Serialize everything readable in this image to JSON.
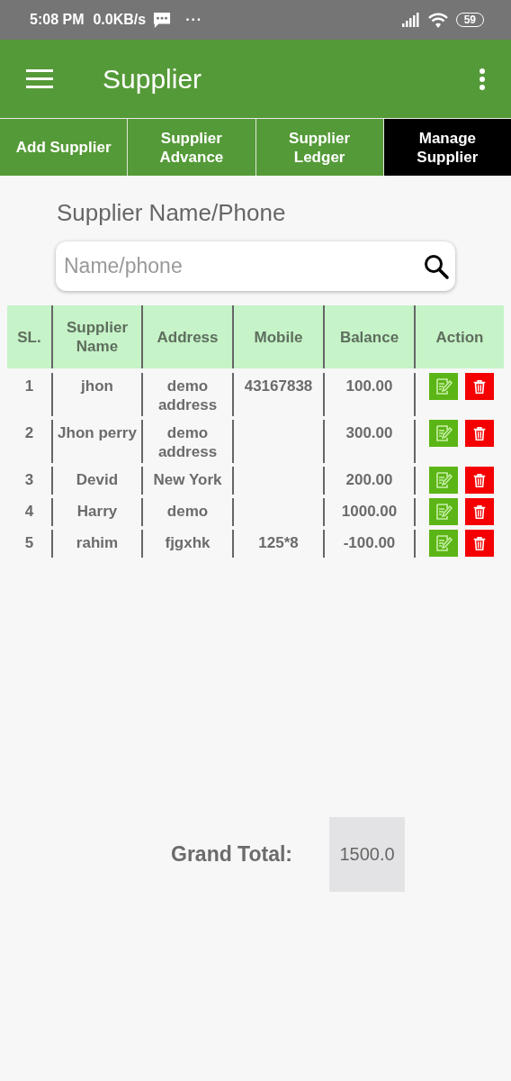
{
  "status_bar": {
    "time": "5:08 PM",
    "speed": "0.0KB/s",
    "more": "···",
    "battery": "59"
  },
  "app_bar": {
    "title": "Supplier"
  },
  "tabs": [
    {
      "label": "Add Supplier",
      "selected": false
    },
    {
      "label": "Supplier Advance",
      "selected": false
    },
    {
      "label": "Supplier Ledger",
      "selected": false
    },
    {
      "label": "Manage Supplier",
      "selected": true
    }
  ],
  "search": {
    "label": "Supplier Name/Phone",
    "placeholder": "Name/phone"
  },
  "table": {
    "columns": [
      "SL.",
      "Supplier Name",
      "Address",
      "Mobile",
      "Balance",
      "Action"
    ],
    "rows": [
      {
        "sl": "1",
        "name": "jhon",
        "address": "demo address",
        "mobile": "43167838",
        "balance": "100.00"
      },
      {
        "sl": "2",
        "name": "Jhon perry",
        "address": "demo address",
        "balance": "300.00"
      },
      {
        "sl": "3",
        "name": "Devid",
        "address": "New York",
        "balance": "200.00"
      },
      {
        "sl": "4",
        "name": "Harry",
        "address": "demo",
        "balance": "1000.00"
      },
      {
        "sl": "5",
        "name": "rahim",
        "address": "fjgxhk",
        "mobile": "125*8",
        "balance": "-100.00"
      }
    ]
  },
  "grand_total": {
    "label": "Grand Total:",
    "value": "1500.0"
  }
}
